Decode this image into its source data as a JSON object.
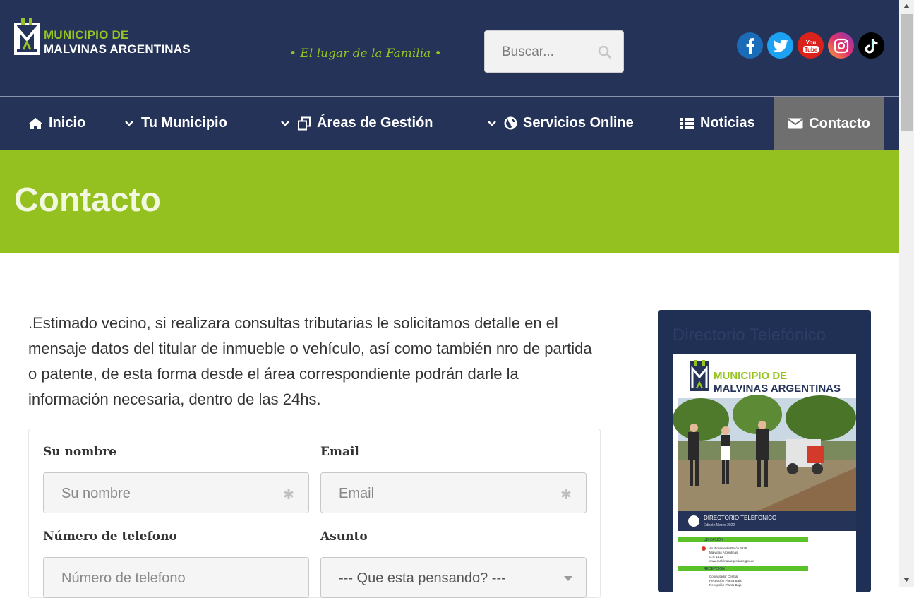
{
  "header": {
    "logo": {
      "line1": "MUNICIPIO DE",
      "line2": "MALVINAS ARGENTINAS"
    },
    "tagline": "• El lugar de la Familia •",
    "search": {
      "placeholder": "Buscar..."
    },
    "social": [
      {
        "name": "facebook-icon",
        "glyph": "f",
        "color": "#1a6bb8"
      },
      {
        "name": "twitter-icon",
        "glyph": "t",
        "color": "#1da1f2"
      },
      {
        "name": "youtube-icon",
        "glyph": "You Tube",
        "color": "#d9221c"
      },
      {
        "name": "instagram-icon",
        "glyph": "",
        "color": "#c13584"
      },
      {
        "name": "tiktok-icon",
        "glyph": "♪",
        "color": "#000000"
      }
    ]
  },
  "nav": {
    "items": [
      {
        "label": "Inicio",
        "icon": "home-icon"
      },
      {
        "label": "Tu Municipio",
        "icon": "chevron-down-icon"
      },
      {
        "label": "Áreas de Gestión",
        "icon": "copy-icon"
      },
      {
        "label": "Servicios Online",
        "icon": "globe-icon"
      },
      {
        "label": "Noticias",
        "icon": "list-icon"
      },
      {
        "label": "Contacto",
        "icon": "envelope-icon",
        "active": true
      }
    ]
  },
  "hero": {
    "title": "Contacto"
  },
  "intro": ".Estimado vecino, si realizara consultas tributarias le solicitamos detalle en el mensaje datos del titular de inmueble o vehículo, así como también nro de partida o patente, de esta forma desde el área correspondiente podrán darle la información necesaria, dentro de las 24hs.",
  "form": {
    "name": {
      "label": "Su nombre",
      "placeholder": "Su nombre"
    },
    "email": {
      "label": "Email",
      "placeholder": "Email"
    },
    "phone": {
      "label": "Número de telefono",
      "placeholder": "Número de telefono"
    },
    "subject": {
      "label": "Asunto",
      "selected": "--- Que esta pensando? ---"
    }
  },
  "directory": {
    "title": "Directorio Telefónico",
    "cover": {
      "line1": "MUNICIPIO DE",
      "line2": "MALVINAS ARGENTINAS",
      "band_title": "DIRECTORIO TELEFONICO",
      "band_sub": "Edición Marzo 2022",
      "section1": "UBICACIÓN",
      "address": [
        "Av. Presidente Perón 4276",
        "Malvinas Argentinas",
        "C.P. 1613",
        "www.malvinasargentinas.gov.ar"
      ],
      "section2": "RECEPCIÓN",
      "reception": [
        "Conmutador Central",
        "Recepción Planta Baja",
        "Recepción Planta Baja"
      ]
    }
  },
  "colors": {
    "navy": "#253358",
    "green": "#94c11f",
    "active_tab": "#6f6f70",
    "active_underline": "#7bb7e6"
  }
}
